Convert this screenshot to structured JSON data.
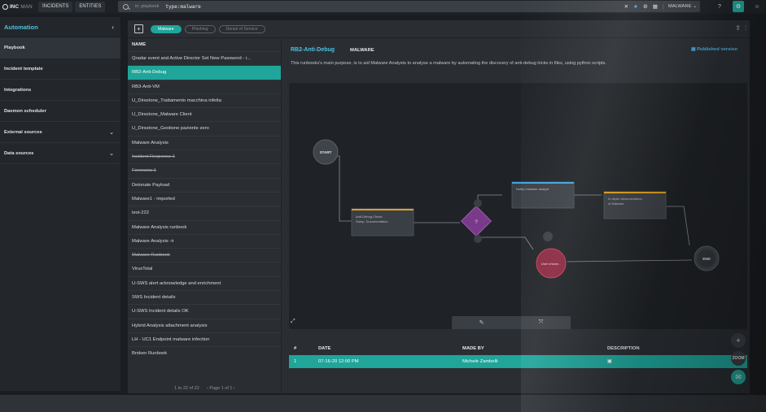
{
  "topbar": {
    "logo_bold": "INC",
    "logo_light": "MAN",
    "nav": [
      "INCIDENTS",
      "ENTITIES"
    ],
    "search_scope": "in: playbook",
    "search_query": "type:malware",
    "close_glyph": "✕",
    "star_glyph": "★",
    "selector_label": "MALWARE"
  },
  "sidebar": {
    "title": "Automation",
    "items": [
      {
        "label": "Playbook",
        "expandable": false
      },
      {
        "label": "Incident template",
        "expandable": false
      },
      {
        "label": "Integrations",
        "expandable": false
      },
      {
        "label": "Daemon scheduler",
        "expandable": false
      },
      {
        "label": "External sources",
        "expandable": true
      },
      {
        "label": "Data sources",
        "expandable": true
      }
    ]
  },
  "filters": [
    "Malware",
    "Phishing",
    "Denial of Service"
  ],
  "list": {
    "header": "NAME",
    "rows": [
      {
        "name": "Qradar event and Active Director Set New Password - i...",
        "strike": false
      },
      {
        "name": "RB2-Anti-Debug",
        "strike": false,
        "selected": true
      },
      {
        "name": "RB3-Anti-VM",
        "strike": false
      },
      {
        "name": "U_Direzione_Trattamento macchina infetta",
        "strike": false
      },
      {
        "name": "U_Direzione_Malware Client",
        "strike": false
      },
      {
        "name": "U_Direzione_Gestione paziente zero",
        "strike": false
      },
      {
        "name": "Malware Analysis",
        "strike": false
      },
      {
        "name": "Incident Response 1",
        "strike": true
      },
      {
        "name": "Forensics 1",
        "strike": true
      },
      {
        "name": "Detonate Payload",
        "strike": false
      },
      {
        "name": "Malware1 - imported",
        "strike": false
      },
      {
        "name": "test-222",
        "strike": false
      },
      {
        "name": "Malware Analysis runbook",
        "strike": false
      },
      {
        "name": "Malware Analysis -ir",
        "strike": false
      },
      {
        "name": "Malware Runbook",
        "strike": true
      },
      {
        "name": "VirusTotal",
        "strike": false
      },
      {
        "name": "U-SWS alert acknowledge and enrichment",
        "strike": false
      },
      {
        "name": "SWS Incident details",
        "strike": false
      },
      {
        "name": "U-SWS Incident details OK",
        "strike": false
      },
      {
        "name": "Hybrid Analysis attachment analysis",
        "strike": false
      },
      {
        "name": "LH - UC1 Endpoint malware infection",
        "strike": false
      },
      {
        "name": "Broken Runbook",
        "strike": false
      }
    ],
    "range_text": "1 to 22 of 22",
    "page_text": "Page 1 of 1"
  },
  "detail": {
    "title": "RB2-Anti-Debug",
    "tag": "MALWARE",
    "published": "Published version",
    "description": "This runbooks's main purpose, is to aid Malware Analysts to analyse a malware by automating the discovery of anti-debug tricks in files, using python scripts.",
    "nodes": {
      "start": "START",
      "end": "END",
      "task1": "Anti-Debug Check\nSamp. Documentation",
      "task2": "Notify malware analyst",
      "task3": "In depth documentation\nof Malware",
      "user": "User choice..."
    }
  },
  "versions": {
    "headers": [
      "#",
      "DATE",
      "MADE BY",
      "DESCRIPTION"
    ],
    "rows": [
      {
        "num": "1",
        "date": "07-16-20 12:00 PM",
        "made_by": "Michele Zambelli",
        "description": ""
      }
    ]
  },
  "fab": {
    "zoom_label": "ZOOM"
  },
  "colors": {
    "accent": "#1fa59a",
    "link": "#4fc2e0",
    "task_orange": "#e0a020",
    "task_blue": "#3ea4e0",
    "user_red": "#c2405a",
    "decision_purple": "#7a3a8a"
  }
}
